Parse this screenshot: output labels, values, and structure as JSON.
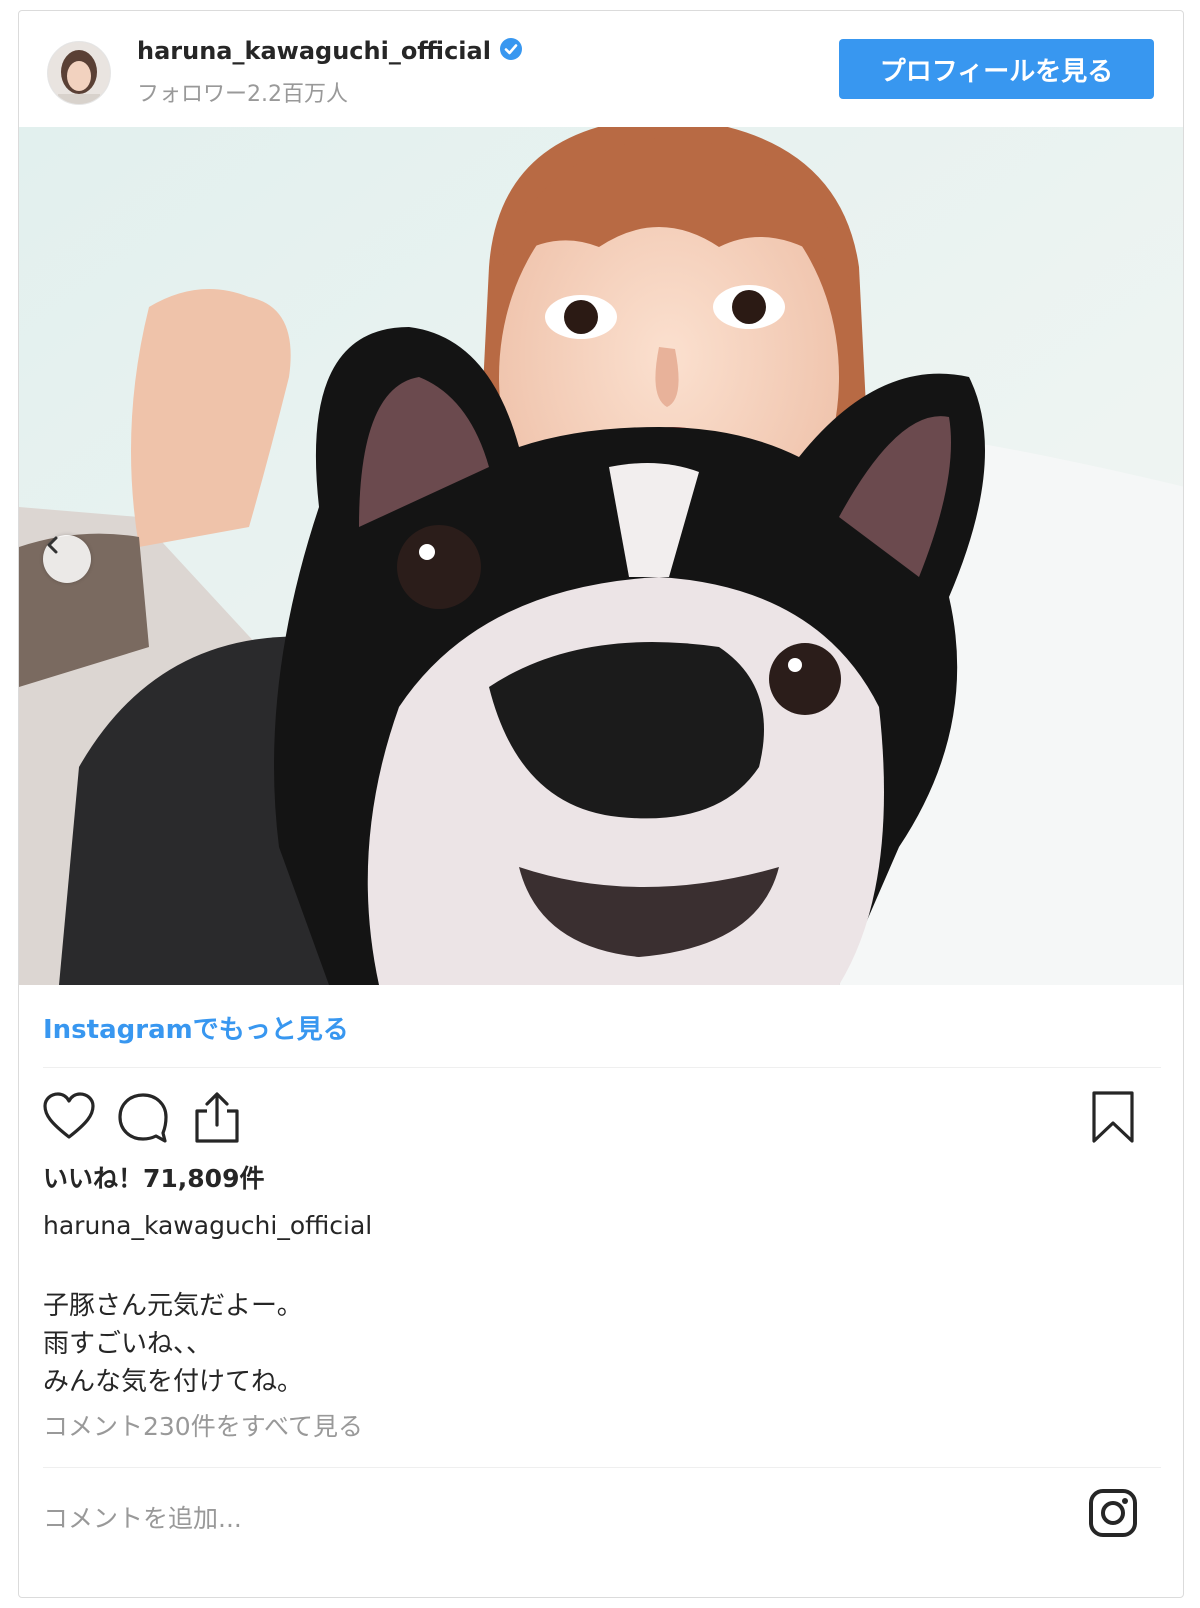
{
  "header": {
    "username": "haruna_kawaguchi_official",
    "followers": "フォロワー2.2百万人",
    "profile_button": "プロフィールを見る"
  },
  "post": {
    "more_link": "Instagramでもっと見る",
    "likes": "いいね！71,809件",
    "caption_user": "haruna_kawaguchi_official",
    "caption_lines": [
      "子豚さん元気だよー。",
      "雨すごいね、、",
      "みんな気を付けてね。"
    ],
    "comments_link": "コメント230件をすべて見る",
    "comment_placeholder": "コメントを追加..."
  },
  "icons": [
    "verified-badge-icon",
    "chevron-left-icon",
    "heart-icon",
    "comment-icon",
    "share-icon",
    "bookmark-icon",
    "instagram-icon"
  ],
  "colors": {
    "accent": "#3897f0",
    "muted": "#999999",
    "text": "#262626"
  }
}
